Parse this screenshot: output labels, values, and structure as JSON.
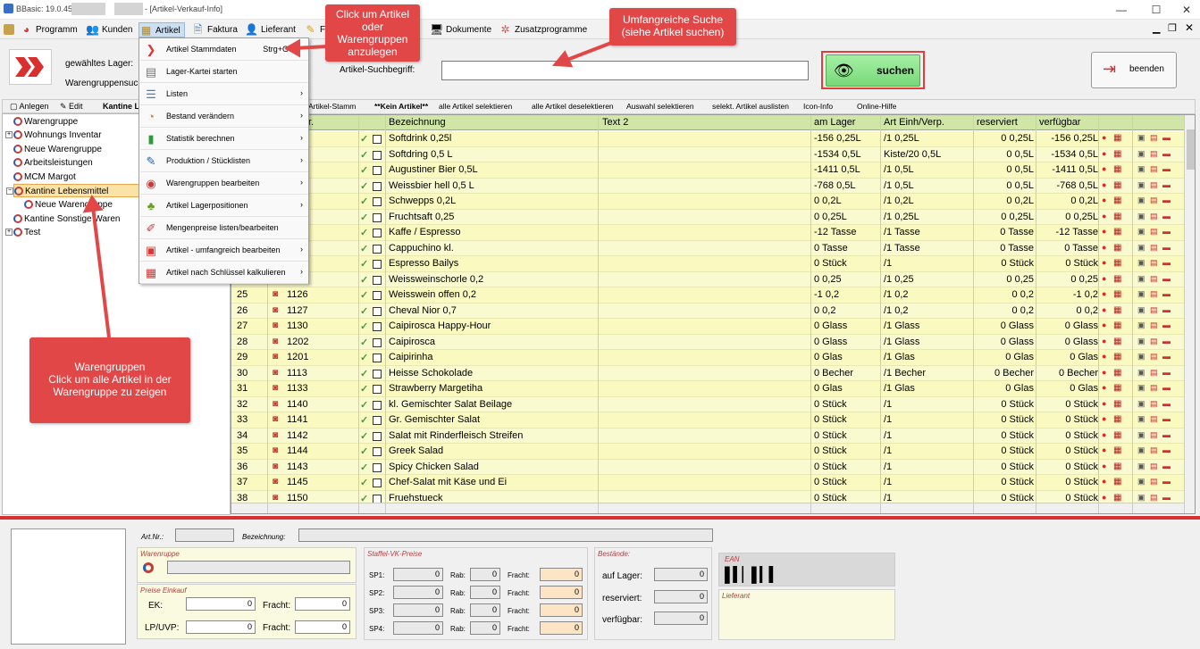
{
  "window": {
    "title_left": "BBasic: 19.0.45.C",
    "title_right": "- [Artikel-Verkauf-Info]",
    "min": "—",
    "max": "☐",
    "close": "✕"
  },
  "menu": {
    "items": [
      "Programm",
      "Kunden",
      "Artikel",
      "Faktura",
      "Lieferant",
      "Fi",
      "Dokumente",
      "Zusatzprogramme"
    ]
  },
  "header": {
    "lager_label": "gewähltes Lager:",
    "wg_label": "Warengruppensuc",
    "search_label": "Artikel-Suchbegriff:",
    "search_value": "",
    "suchen": "suchen",
    "beenden": "beenden"
  },
  "lefttool": {
    "anlegen": "Anlegen",
    "edit": "Edit",
    "kantine": "Kantine Le"
  },
  "tree": [
    "Warengruppe",
    "Wohnungs Inventar",
    "Neue Warengruppe",
    "Arbeitsleistungen",
    "MCM Margot",
    "Kantine Lebensmittel",
    "Neue Warengruppe",
    "Kantine Sonstige Waren",
    "Test"
  ],
  "gridtool": [
    "Artikel-Stamm",
    "**Kein Artikel**",
    "alle Artikel selektieren",
    "alle Artikel deselektieren",
    "Auswahl selektieren",
    "selekt. Artikel auslisten",
    "Icon-Info",
    "Online-Hilfe"
  ],
  "columns": {
    "nr": "r.",
    "bez": "Bezeichnung",
    "text2": "Text 2",
    "lager": "am Lager",
    "einh": "Art Einh/Verp.",
    "res": "reserviert",
    "verf": "verfügbar"
  },
  "rows": [
    {
      "n": "",
      "nr": "",
      "bez": "Softdrink 0,25l",
      "lager": "-156 0,25L",
      "einh": "/1 0,25L",
      "res": "0 0,25L",
      "verf": "-156 0,25L"
    },
    {
      "n": "",
      "nr": "",
      "bez": "Softdring 0,5 L",
      "lager": "-1534 0,5L",
      "einh": "Kiste/20 0,5L",
      "res": "0 0,5L",
      "verf": "-1534 0,5L"
    },
    {
      "n": "",
      "nr": "",
      "bez": "Augustiner Bier 0,5L",
      "lager": "-1411 0,5L",
      "einh": "/1 0,5L",
      "res": "0 0,5L",
      "verf": "-1411 0,5L"
    },
    {
      "n": "",
      "nr": "",
      "bez": "Weissbier hell  0,5 L",
      "lager": "-768 0,5L",
      "einh": "/1 0,5L",
      "res": "0 0,5L",
      "verf": "-768 0,5L"
    },
    {
      "n": "",
      "nr": "",
      "bez": "Schwepps 0,2L",
      "lager": "0 0,2L",
      "einh": "/1 0,2L",
      "res": "0 0,2L",
      "verf": "0 0,2L"
    },
    {
      "n": "",
      "nr": "",
      "bez": "Fruchtsaft 0,25",
      "lager": "0 0,25L",
      "einh": "/1 0,25L",
      "res": "0 0,25L",
      "verf": "0 0,25L"
    },
    {
      "n": "",
      "nr": "",
      "bez": "Kaffe / Espresso",
      "lager": "-12 Tasse",
      "einh": "/1 Tasse",
      "res": "0 Tasse",
      "verf": "-12 Tasse"
    },
    {
      "n": "",
      "nr": "",
      "bez": "Cappuchino kl.",
      "lager": "0 Tasse",
      "einh": "/1 Tasse",
      "res": "0 Tasse",
      "verf": "0 Tasse"
    },
    {
      "n": "",
      "nr": "",
      "bez": "Espresso Bailys",
      "lager": "0 Stück",
      "einh": "/1",
      "res": "0 Stück",
      "verf": "0 Stück"
    },
    {
      "n": "",
      "nr": "",
      "bez": "Weissweinschorle 0,2",
      "lager": "0 0,25",
      "einh": "/1 0,25",
      "res": "0 0,25",
      "verf": "0 0,25"
    },
    {
      "n": "25",
      "nr": "1126",
      "bez": "Weisswein offen 0,2",
      "lager": "-1 0,2",
      "einh": "/1 0,2",
      "res": "0 0,2",
      "verf": "-1 0,2"
    },
    {
      "n": "26",
      "nr": "1127",
      "bez": "Cheval Nior 0,7",
      "lager": "0 0,2",
      "einh": "/1 0,2",
      "res": "0 0,2",
      "verf": "0 0,2"
    },
    {
      "n": "27",
      "nr": "1130",
      "bez": "Caipirosca Happy-Hour",
      "lager": "0 Glass",
      "einh": "/1 Glass",
      "res": "0 Glass",
      "verf": "0 Glass"
    },
    {
      "n": "28",
      "nr": "1202",
      "bez": "Caipirosca",
      "lager": "0 Glass",
      "einh": "/1 Glass",
      "res": "0 Glass",
      "verf": "0 Glass"
    },
    {
      "n": "29",
      "nr": "1201",
      "bez": "Caipirinha",
      "lager": "0 Glas",
      "einh": "/1 Glas",
      "res": "0 Glas",
      "verf": "0 Glas"
    },
    {
      "n": "30",
      "nr": "1113",
      "bez": "Heisse Schokolade",
      "lager": "0 Becher",
      "einh": "/1 Becher",
      "res": "0 Becher",
      "verf": "0 Becher"
    },
    {
      "n": "31",
      "nr": "1133",
      "bez": "Strawberry Margetiha",
      "lager": "0 Glas",
      "einh": "/1 Glas",
      "res": "0 Glas",
      "verf": "0 Glas"
    },
    {
      "n": "32",
      "nr": "1140",
      "bez": "kl. Gemischter Salat Beilage",
      "lager": "0 Stück",
      "einh": "/1",
      "res": "0 Stück",
      "verf": "0 Stück"
    },
    {
      "n": "33",
      "nr": "1141",
      "bez": "Gr. Gemischter Salat",
      "lager": "0 Stück",
      "einh": "/1",
      "res": "0 Stück",
      "verf": "0 Stück"
    },
    {
      "n": "34",
      "nr": "1142",
      "bez": "Salat mit Rinderfleisch Streifen",
      "lager": "0 Stück",
      "einh": "/1",
      "res": "0 Stück",
      "verf": "0 Stück"
    },
    {
      "n": "35",
      "nr": "1144",
      "bez": "Greek Salad",
      "lager": "0 Stück",
      "einh": "/1",
      "res": "0 Stück",
      "verf": "0 Stück"
    },
    {
      "n": "36",
      "nr": "1143",
      "bez": "Spicy Chicken Salad",
      "lager": "0 Stück",
      "einh": "/1",
      "res": "0 Stück",
      "verf": "0 Stück"
    },
    {
      "n": "37",
      "nr": "1145",
      "bez": "Chef-Salat mit Käse und Ei",
      "lager": "0 Stück",
      "einh": "/1",
      "res": "0 Stück",
      "verf": "0 Stück"
    },
    {
      "n": "38",
      "nr": "1150",
      "bez": "Fruehstueck",
      "lager": "0 Stück",
      "einh": "/1",
      "res": "0 Stück",
      "verf": "0 Stück"
    }
  ],
  "dropdown": [
    {
      "label": "Artikel Stammdaten",
      "key": "Strg+G",
      "arrow": ""
    },
    {
      "label": "Lager-Kartei starten",
      "key": "",
      "arrow": ""
    },
    {
      "label": "Listen",
      "key": "",
      "arrow": "›"
    },
    {
      "label": "Bestand verändern",
      "key": "",
      "arrow": "›"
    },
    {
      "label": "Statistik berechnen",
      "key": "",
      "arrow": "›"
    },
    {
      "label": "Produktion / Stücklisten",
      "key": "",
      "arrow": "›"
    },
    {
      "label": "Warengruppen bearbeiten",
      "key": "",
      "arrow": "›"
    },
    {
      "label": "Artikel Lagerpositionen",
      "key": "",
      "arrow": "›"
    },
    {
      "label": "Mengenpreise listen/bearbeiten",
      "key": "",
      "arrow": ""
    },
    {
      "label": "Artikel - umfangreich bearbeiten",
      "key": "",
      "arrow": "›"
    },
    {
      "label": "Artikel nach Schlüssel kalkulieren",
      "key": "",
      "arrow": "›"
    }
  ],
  "callouts": {
    "c1": [
      "Click um Artikel",
      "oder",
      "Warengruppen",
      "anzulegen"
    ],
    "c2": [
      "Umfangreiche Suche",
      "(siehe Artikel suchen)"
    ],
    "c3": [
      "Warengruppen",
      "Click um alle Artikel in der",
      "Warengruppe zu zeigen"
    ]
  },
  "bottom": {
    "artnr": "Art.Nr.:",
    "bez": "Bezeichnung:",
    "warengruppe": "Warenruppe",
    "preise_einkauf": "Preise Einkauf",
    "ek": "EK:",
    "lp": "LP/UVP:",
    "fracht": "Fracht:",
    "staffel": "Staffel-VK-Preise",
    "sp": [
      "SP1:",
      "SP2:",
      "SP3:",
      "SP4:"
    ],
    "rab": "Rab:",
    "fracht_s": "Fracht:",
    "bestaende": "Bestände:",
    "auf_lager": "auf Lager:",
    "reserviert": "reserviert:",
    "verfuegbar": "verfügbar:",
    "ean": "EAN",
    "lieferant": "Lieferant",
    "zero": "0"
  }
}
